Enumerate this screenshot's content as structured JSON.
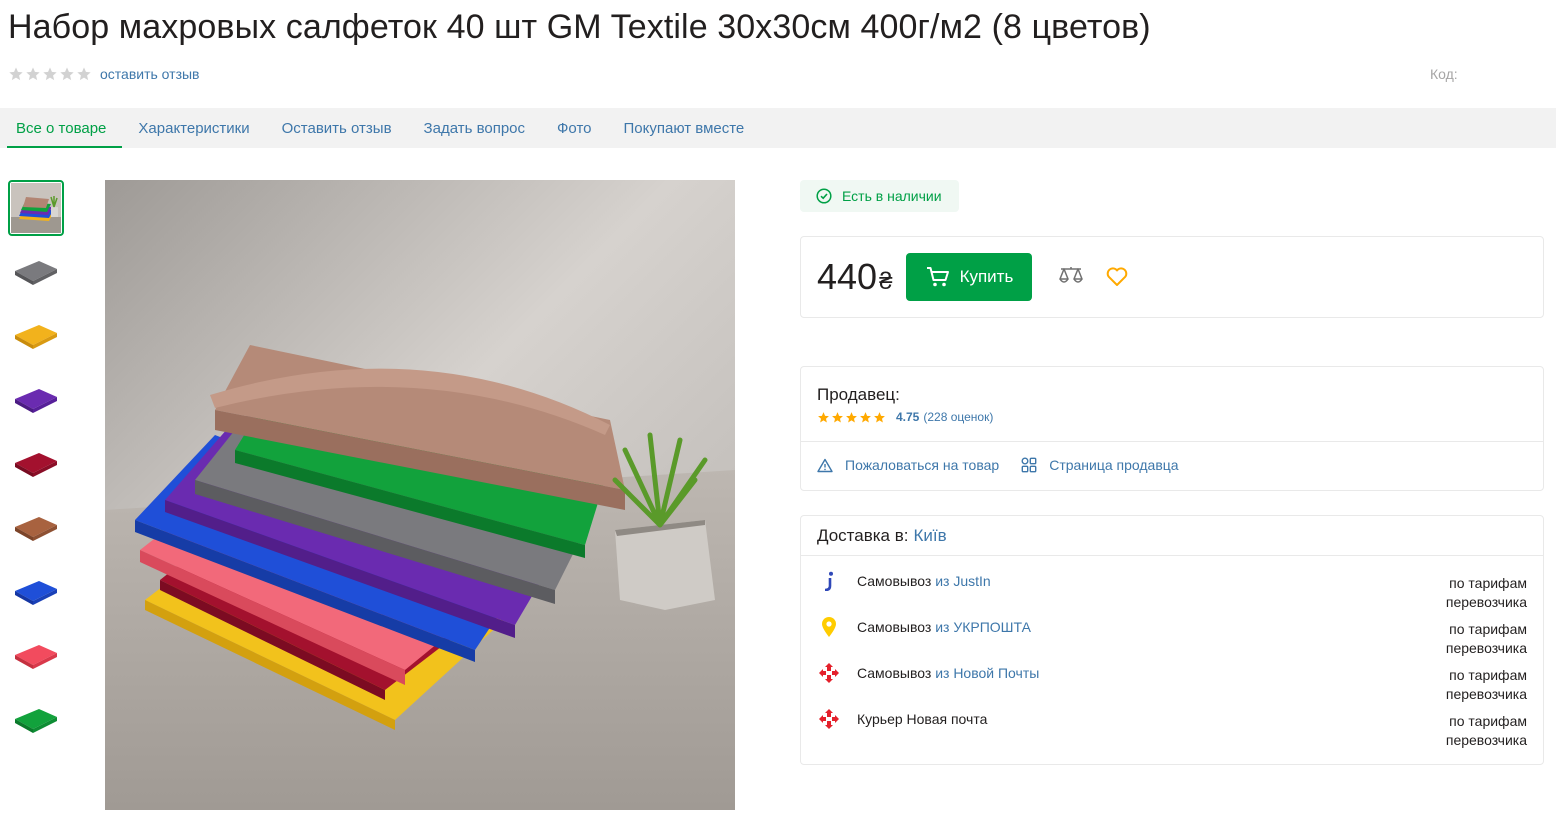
{
  "product": {
    "title": "Набор махровых салфеток 40 шт GM Textile 30x30см 400г/м2 (8 цветов)",
    "review_link": "оставить отзыв",
    "code_label": "Код:"
  },
  "tabs": [
    {
      "label": "Все о товаре"
    },
    {
      "label": "Характеристики"
    },
    {
      "label": "Оставить отзыв"
    },
    {
      "label": "Задать вопрос"
    },
    {
      "label": "Фото"
    },
    {
      "label": "Покупают вместе"
    }
  ],
  "thumbnails": [
    {
      "name": "photo-stack"
    },
    {
      "name": "gray",
      "color": "#7a7a7e"
    },
    {
      "name": "yellow",
      "color": "#f2b21c"
    },
    {
      "name": "purple",
      "color": "#6a2bb0"
    },
    {
      "name": "burgundy",
      "color": "#a3112e"
    },
    {
      "name": "brown",
      "color": "#a8623f"
    },
    {
      "name": "blue",
      "color": "#1f4fd8"
    },
    {
      "name": "pink",
      "color": "#f24b5e"
    },
    {
      "name": "green",
      "color": "#12a23c"
    }
  ],
  "stock": {
    "label": "Есть в наличии"
  },
  "buy": {
    "price": "440",
    "currency": "₴",
    "button_label": "Купить"
  },
  "seller": {
    "label": "Продавец:",
    "rating": "4.75",
    "reviews": "(228 оценок)",
    "complain_link": "Пожаловаться на товар",
    "page_link": "Страница продавца"
  },
  "delivery": {
    "label": "Доставка в:",
    "city": "Київ",
    "options": [
      {
        "method": "Самовывоз",
        "from": "из JustIn",
        "tariff_1": "по тарифам",
        "tariff_2": "перевозчика",
        "icon": "justin-icon"
      },
      {
        "method": "Самовывоз",
        "from": "из УКРПОШТА",
        "tariff_1": "по тарифам",
        "tariff_2": "перевозчика",
        "icon": "ukrposhta-icon"
      },
      {
        "method": "Самовывоз",
        "from": "из Новой Почты",
        "tariff_1": "по тарифам",
        "tariff_2": "перевозчика",
        "icon": "nova-poshta-icon"
      },
      {
        "method": "Курьер Новая почта",
        "from": "",
        "tariff_1": "по тарифам",
        "tariff_2": "перевозчика",
        "icon": "nova-poshta-icon"
      }
    ]
  },
  "colors": {
    "brand_green": "#00a046",
    "link_blue": "#3e77aa",
    "star_gold": "#ffa900",
    "np_red": "#e4202b"
  }
}
